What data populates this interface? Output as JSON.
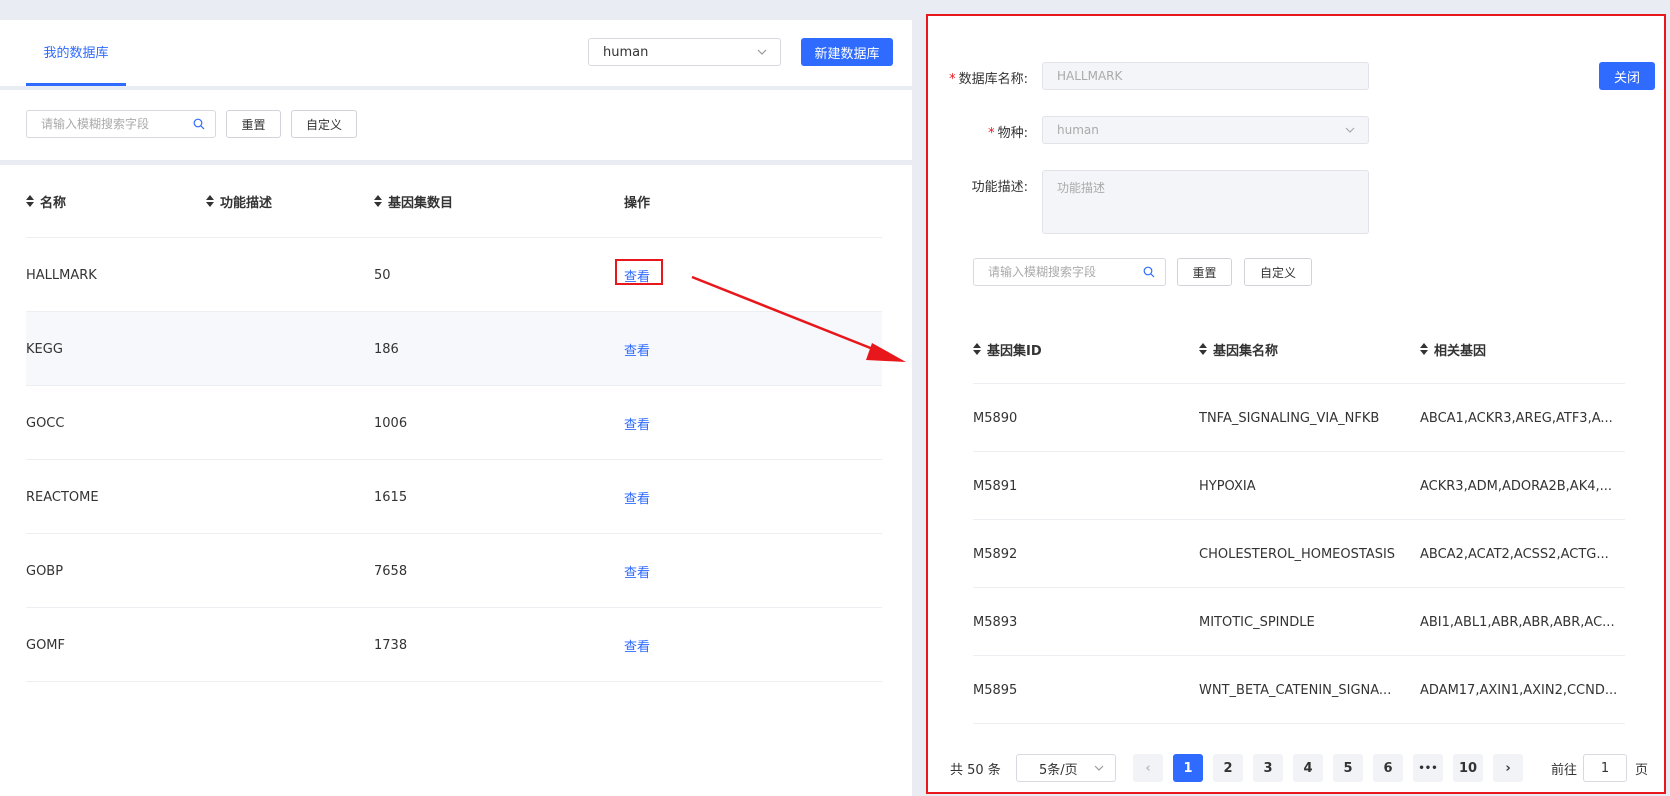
{
  "left": {
    "tab_label": "我的数据库",
    "species_value": "human",
    "new_db_label": "新建数据库",
    "search_placeholder": "请输入模糊搜索字段",
    "reset_label": "重置",
    "custom_label": "自定义",
    "columns": [
      "名称",
      "功能描述",
      "基因集数目",
      "操作"
    ],
    "rows": [
      {
        "name": "HALLMARK",
        "desc": "",
        "count": "50",
        "action": "查看"
      },
      {
        "name": "KEGG",
        "desc": "",
        "count": "186",
        "action": "查看"
      },
      {
        "name": "GOCC",
        "desc": "",
        "count": "1006",
        "action": "查看"
      },
      {
        "name": "REACTOME",
        "desc": "",
        "count": "1615",
        "action": "查看"
      },
      {
        "name": "GOBP",
        "desc": "",
        "count": "7658",
        "action": "查看"
      },
      {
        "name": "GOMF",
        "desc": "",
        "count": "1738",
        "action": "查看"
      }
    ]
  },
  "right": {
    "db_name_label": "数据库名称:",
    "db_name_value": "HALLMARK",
    "species_label": "物种:",
    "species_value": "human",
    "desc_label": "功能描述:",
    "desc_placeholder": "功能描述",
    "close_label": "关闭",
    "search_placeholder": "请输入模糊搜索字段",
    "reset_label": "重置",
    "custom_label": "自定义",
    "columns": [
      "基因集ID",
      "基因集名称",
      "相关基因"
    ],
    "rows": [
      {
        "id": "M5890",
        "name": "TNFA_SIGNALING_VIA_NFKB",
        "genes": "ABCA1,ACKR3,AREG,ATF3,A..."
      },
      {
        "id": "M5891",
        "name": "HYPOXIA",
        "genes": "ACKR3,ADM,ADORA2B,AK4,..."
      },
      {
        "id": "M5892",
        "name": "CHOLESTEROL_HOMEOSTASIS",
        "genes": "ABCA2,ACAT2,ACSS2,ACTG..."
      },
      {
        "id": "M5893",
        "name": "MITOTIC_SPINDLE",
        "genes": "ABI1,ABL1,ABR,ABR,ABR,AC..."
      },
      {
        "id": "M5895",
        "name": "WNT_BETA_CATENIN_SIGNA...",
        "genes": "ADAM17,AXIN1,AXIN2,CCND..."
      }
    ],
    "pagination": {
      "total": "共 50 条",
      "page_size": "5条/页",
      "prev": "‹",
      "pages": [
        "1",
        "2",
        "3",
        "4",
        "5",
        "6",
        "•••",
        "10"
      ],
      "next": "›",
      "goto_prefix": "前往",
      "goto_value": "1",
      "goto_suffix": "页"
    }
  },
  "colors": {
    "primary": "#2f6bff",
    "highlight": "#e8171b"
  }
}
